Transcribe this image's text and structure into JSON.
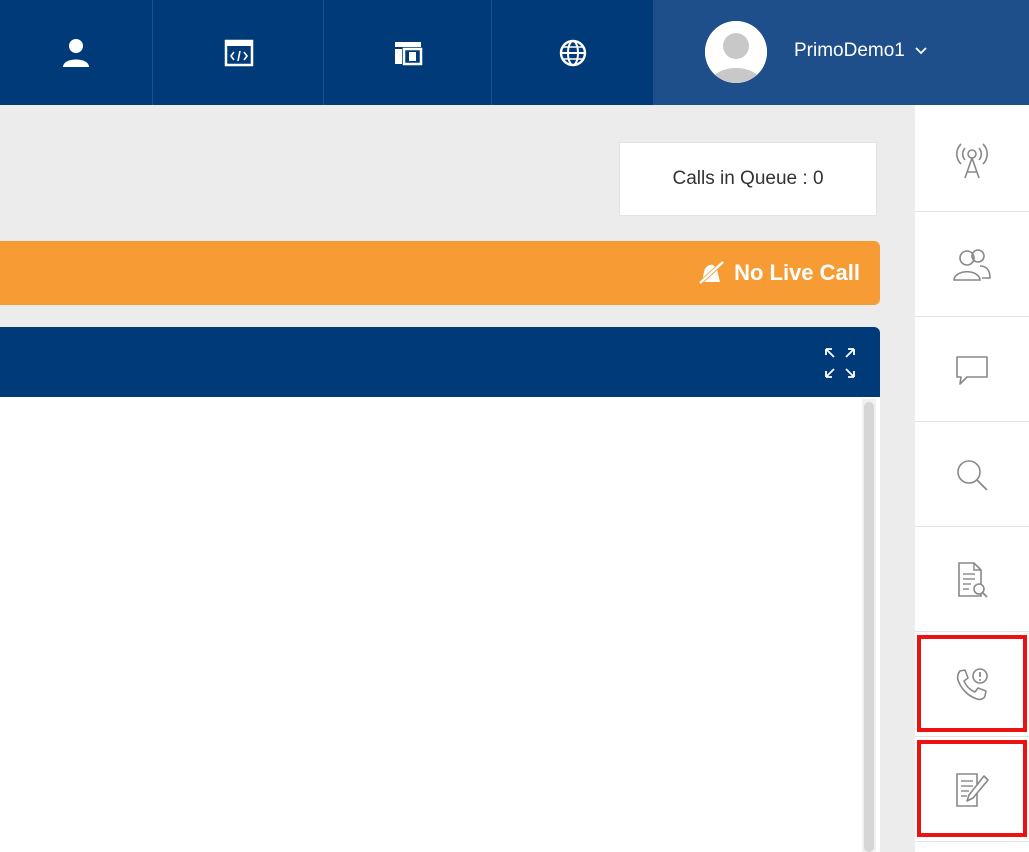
{
  "header": {
    "nav_icons": [
      "user-icon",
      "code-window-icon",
      "dashboard-icon",
      "globe-icon"
    ],
    "user": {
      "name": "PrimoDemo1",
      "dropdown_icon": "chevron-down-icon"
    }
  },
  "queue": {
    "label": "Calls in Queue : 0"
  },
  "live_call": {
    "status": "No Live Call",
    "icon": "bell-slash-icon"
  },
  "panel": {
    "expand_icon": "expand-icon"
  },
  "sidebar": {
    "items": [
      {
        "icon": "broadcast-tower-icon"
      },
      {
        "icon": "contacts-icon"
      },
      {
        "icon": "chat-icon"
      },
      {
        "icon": "search-icon"
      },
      {
        "icon": "document-search-icon"
      },
      {
        "icon": "phone-info-icon",
        "highlighted": true
      },
      {
        "icon": "notes-edit-icon",
        "highlighted": true
      }
    ]
  },
  "colors": {
    "nav_bg": "#003a78",
    "user_bg": "#1f4f8a",
    "live_bar": "#f79c34",
    "highlight": "#ee1111",
    "page_bg": "#ececec"
  }
}
